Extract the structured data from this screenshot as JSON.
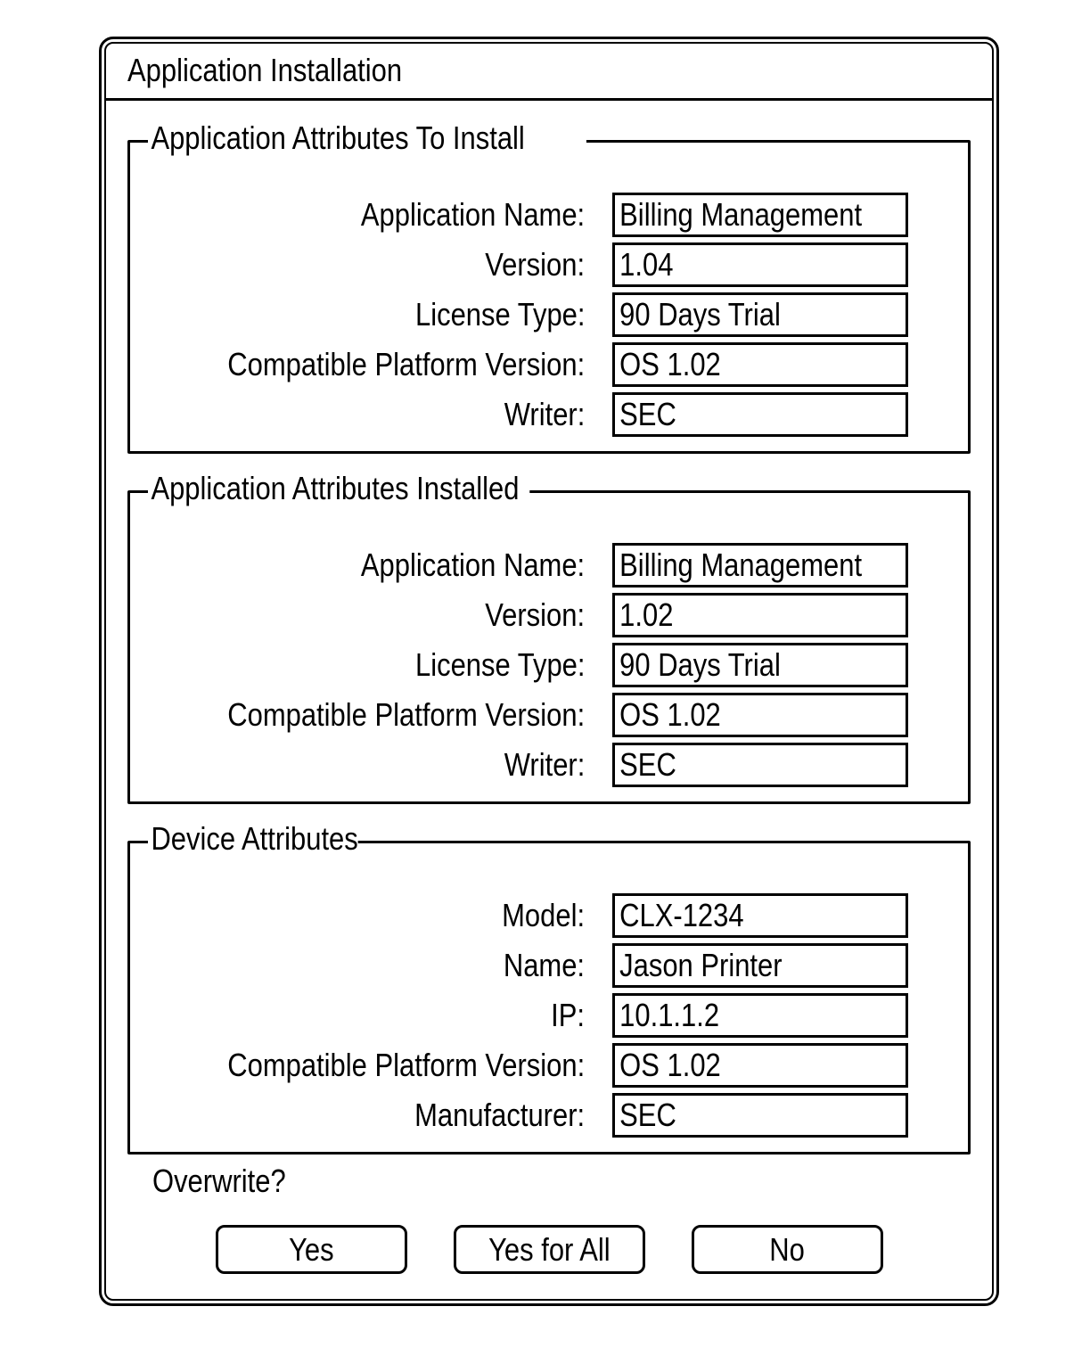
{
  "window": {
    "title": "Application Installation"
  },
  "sections": [
    {
      "legend": "Application Attributes To Install",
      "rows": [
        {
          "label": "Application Name:",
          "value": "Billing Management"
        },
        {
          "label": "Version:",
          "value": "1.04"
        },
        {
          "label": "License Type:",
          "value": "90 Days Trial"
        },
        {
          "label": "Compatible Platform Version:",
          "value": "OS 1.02"
        },
        {
          "label": "Writer:",
          "value": "SEC"
        }
      ]
    },
    {
      "legend": "Application Attributes Installed",
      "rows": [
        {
          "label": "Application Name:",
          "value": "Billing Management"
        },
        {
          "label": "Version:",
          "value": "1.02"
        },
        {
          "label": "License Type:",
          "value": "90 Days Trial"
        },
        {
          "label": "Compatible Platform Version:",
          "value": "OS 1.02"
        },
        {
          "label": "Writer:",
          "value": "SEC"
        }
      ]
    },
    {
      "legend": "Device Attributes",
      "rows": [
        {
          "label": "Model:",
          "value": "CLX-1234"
        },
        {
          "label": "Name:",
          "value": "Jason Printer"
        },
        {
          "label": "IP:",
          "value": "10.1.1.2"
        },
        {
          "label": "Compatible Platform Version:",
          "value": "OS 1.02"
        },
        {
          "label": "Manufacturer:",
          "value": "SEC"
        }
      ]
    }
  ],
  "prompt": {
    "question": "Overwrite?"
  },
  "buttons": {
    "yes": "Yes",
    "yes_for_all": "Yes for All",
    "no": "No"
  }
}
